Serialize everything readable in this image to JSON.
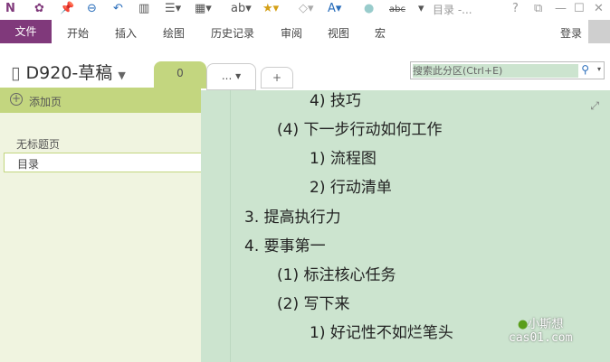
{
  "qat": {
    "icons": [
      "onenote-logo-icon",
      "macro-icon",
      "pin-icon",
      "back-icon",
      "undo-icon",
      "page-layout-icon",
      "numbered-list-icon",
      "table-icon",
      "spelling-icon",
      "tag-icon",
      "highlight-icon",
      "font-color-icon",
      "circle-icon",
      "strikethrough-icon",
      "more-icon"
    ],
    "abc": "abc",
    "title": "目录 -...",
    "help": "?",
    "restore": "⧉",
    "min": "—",
    "max": "☐",
    "close": "✕"
  },
  "ribbon": {
    "file": "文件",
    "tabs": [
      "开始",
      "插入",
      "绘图",
      "历史记录",
      "审阅",
      "视图",
      "宏"
    ],
    "login": "登录"
  },
  "notebook": {
    "name": "D920-草稿",
    "sections": [
      "0",
      "..."
    ],
    "add": "+"
  },
  "search": {
    "placeholder": "搜索此分区(Ctrl+E)"
  },
  "pages": {
    "add": "添加页",
    "items": [
      "无标题页",
      "目录"
    ]
  },
  "content": {
    "lines": [
      "4) 技巧",
      "(4) 下一步行动如何工作",
      "1) 流程图",
      "2) 行动清单",
      "3. 提高执行力",
      "4. 要事第一",
      "(1) 标注核心任务",
      "(2) 写下来",
      "1) 好记性不如烂笔头"
    ]
  },
  "watermark": {
    "name": "小斯想",
    "site": "cas01.com"
  }
}
